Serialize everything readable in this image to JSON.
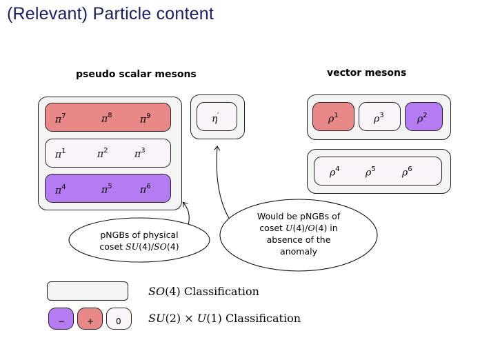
{
  "title": "(Relevant) Particle content",
  "pseudo_scalar": {
    "heading": "pseudo scalar mesons",
    "row_top": [
      {
        "sym": "π",
        "idx": "7"
      },
      {
        "sym": "π",
        "idx": "8"
      },
      {
        "sym": "π",
        "idx": "9"
      }
    ],
    "row_mid": [
      {
        "sym": "π",
        "idx": "1"
      },
      {
        "sym": "π",
        "idx": "2"
      },
      {
        "sym": "π",
        "idx": "3"
      }
    ],
    "row_bot": [
      {
        "sym": "π",
        "idx": "4"
      },
      {
        "sym": "π",
        "idx": "5"
      },
      {
        "sym": "π",
        "idx": "6"
      }
    ],
    "singlet": {
      "sym": "η",
      "idx": "′"
    }
  },
  "vector": {
    "heading": "vector mesons",
    "top": [
      {
        "sym": "ρ",
        "idx": "1"
      },
      {
        "sym": "ρ",
        "idx": "3"
      },
      {
        "sym": "ρ",
        "idx": "2"
      }
    ],
    "bottom": [
      {
        "sym": "ρ",
        "idx": "4"
      },
      {
        "sym": "ρ",
        "idx": "5"
      },
      {
        "sym": "ρ",
        "idx": "6"
      }
    ]
  },
  "notes": {
    "physical": {
      "line1": "pNGBs of physical",
      "line2_prefix": "coset ",
      "line2_math": "SU",
      "line2_rest": "(4)/",
      "line2_math2": "SO",
      "line2_end": "(4)"
    },
    "anomaly": {
      "line1": "Would be pNGBs of",
      "line2_prefix": "coset ",
      "line2_math": "U",
      "line2_rest": "(4)/",
      "line2_math2": "O",
      "line2_end": "(4) in",
      "line3": "absence of the",
      "line4": "anomaly"
    }
  },
  "legend": {
    "so4_math": "SO",
    "so4_text": "(4) Classification",
    "su2_math": "SU",
    "su2_mid": "(2) × ",
    "su2_math2": "U",
    "su2_text": "(1) Classification",
    "signs": [
      "−",
      "+",
      "0"
    ]
  },
  "colors": {
    "title": "#1a1f5c",
    "red": "#e98888",
    "purple": "#b57cf2",
    "light": "#fbf3fa",
    "gray": "#f3f3f3"
  }
}
